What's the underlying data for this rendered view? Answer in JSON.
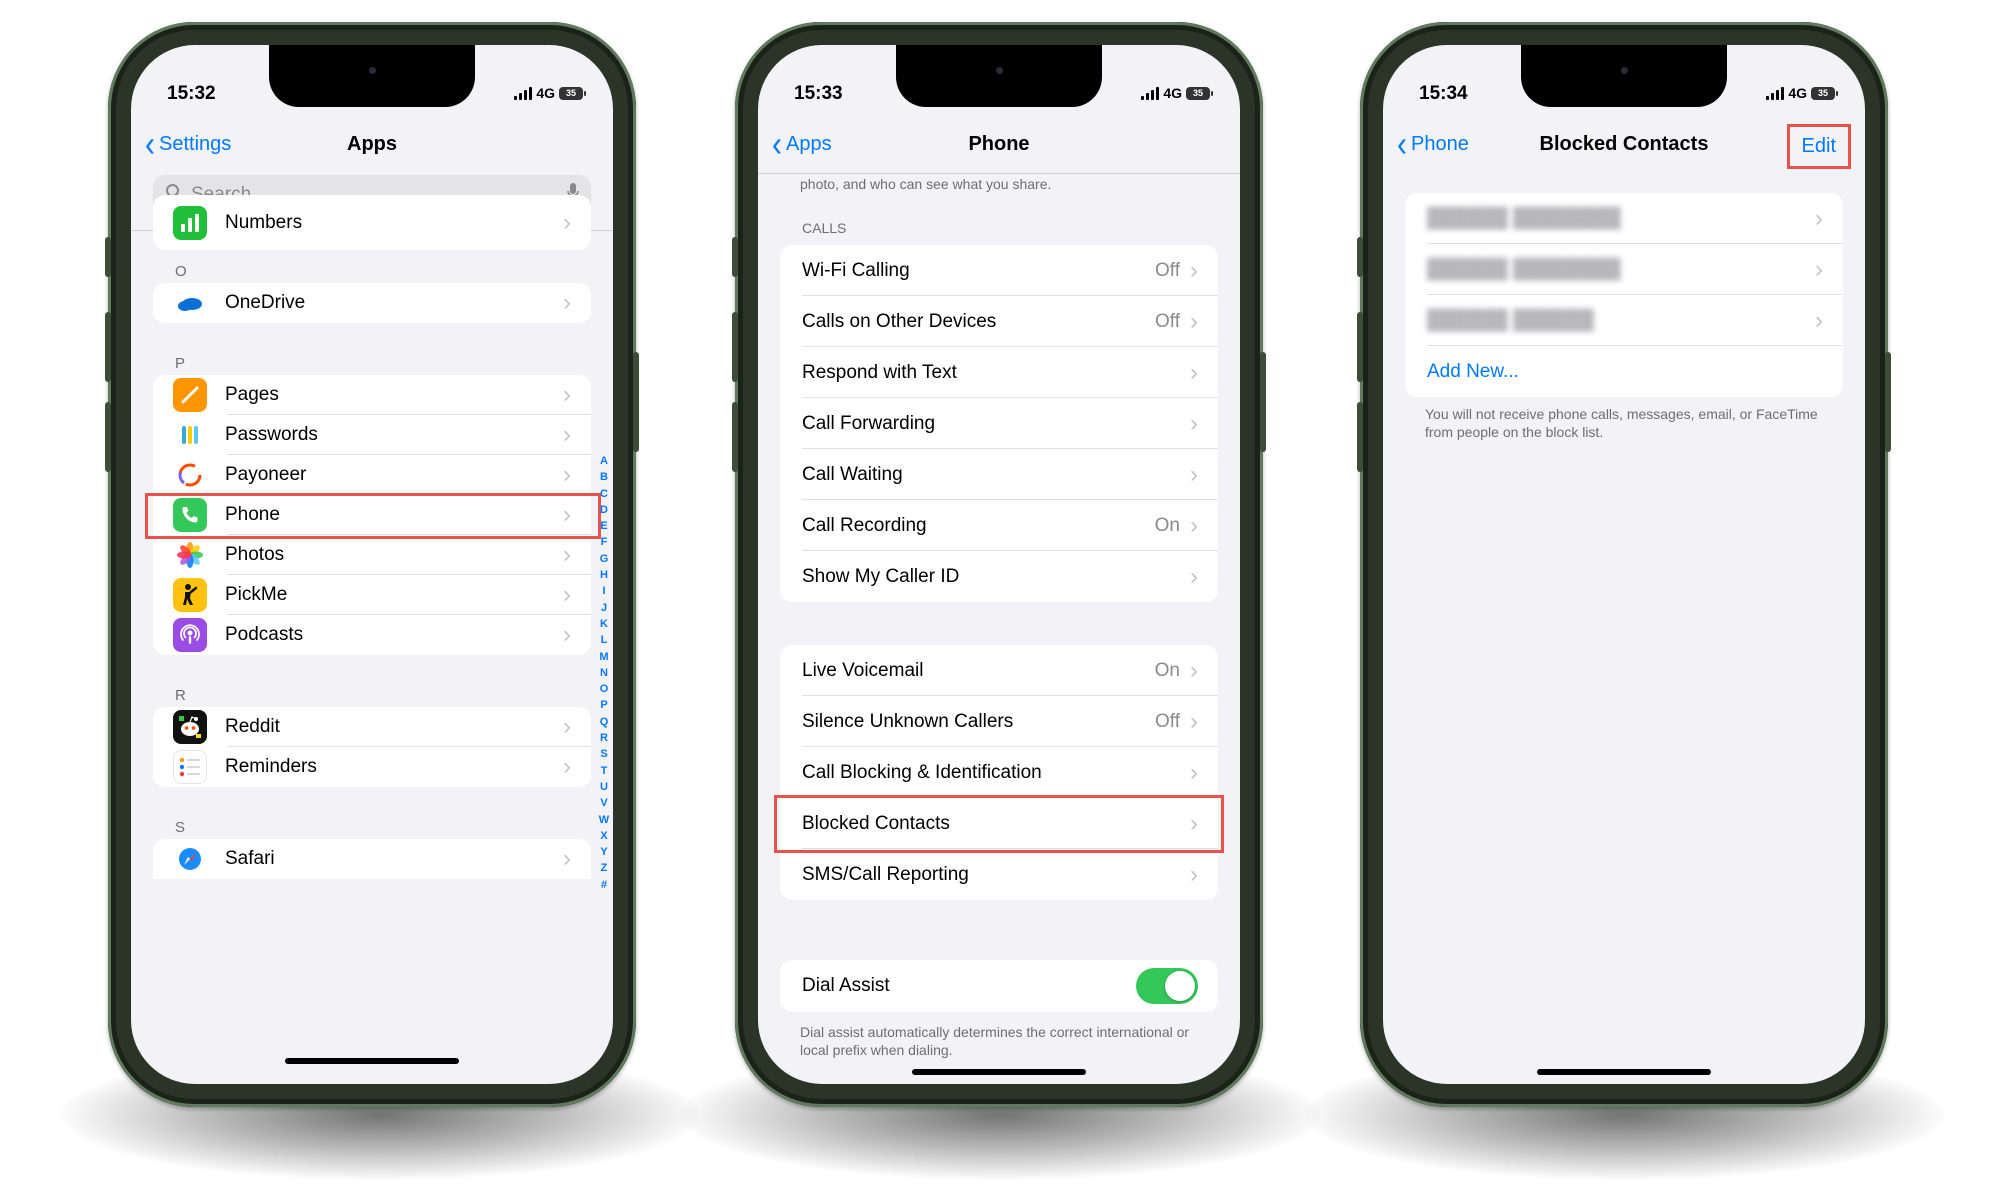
{
  "colors": {
    "ios_blue": "#007aff",
    "highlight_red": "#e8524a",
    "toggle_green": "#34c759",
    "frame": "#2a3528"
  },
  "phone1": {
    "time": "15:32",
    "network": "4G",
    "battery": "35",
    "nav": {
      "back_label": "Settings",
      "title": "Apps"
    },
    "search_placeholder": "Search",
    "section_o": "O",
    "section_p": "P",
    "section_r": "R",
    "section_s": "S",
    "apps": {
      "numbers": "Numbers",
      "onedrive": "OneDrive",
      "pages": "Pages",
      "passwords": "Passwords",
      "payoneer": "Payoneer",
      "phone": "Phone",
      "photos": "Photos",
      "pickme": "PickMe",
      "podcasts": "Podcasts",
      "reddit": "Reddit",
      "reminders": "Reminders",
      "safari": "Safari"
    },
    "index_letters": [
      "A",
      "B",
      "C",
      "D",
      "E",
      "F",
      "G",
      "H",
      "I",
      "J",
      "K",
      "L",
      "M",
      "N",
      "O",
      "P",
      "Q",
      "R",
      "S",
      "T",
      "U",
      "V",
      "W",
      "X",
      "Y",
      "Z",
      "#"
    ],
    "icons": [
      "numbers-icon",
      "onedrive-icon",
      "pages-icon",
      "passwords-icon",
      "payoneer-icon",
      "phone-icon",
      "photos-icon",
      "pickme-icon",
      "podcasts-icon",
      "reddit-icon",
      "reminders-icon",
      "safari-icon"
    ]
  },
  "phone2": {
    "time": "15:33",
    "network": "4G",
    "battery": "35",
    "nav": {
      "back_label": "Apps",
      "title": "Phone"
    },
    "top_note": "photo, and who can see what you share.",
    "calls_header": "CALLS",
    "calls": [
      {
        "label": "Wi-Fi Calling",
        "value": "Off"
      },
      {
        "label": "Calls on Other Devices",
        "value": "Off"
      },
      {
        "label": "Respond with Text",
        "value": ""
      },
      {
        "label": "Call Forwarding",
        "value": ""
      },
      {
        "label": "Call Waiting",
        "value": ""
      },
      {
        "label": "Call Recording",
        "value": "On"
      },
      {
        "label": "Show My Caller ID",
        "value": ""
      }
    ],
    "group2": [
      {
        "label": "Live Voicemail",
        "value": "On"
      },
      {
        "label": "Silence Unknown Callers",
        "value": "Off"
      },
      {
        "label": "Call Blocking & Identification",
        "value": ""
      },
      {
        "label": "Blocked Contacts",
        "value": ""
      },
      {
        "label": "SMS/Call Reporting",
        "value": ""
      }
    ],
    "dial_assist": {
      "label": "Dial Assist",
      "enabled": true
    },
    "dial_assist_note": "Dial assist automatically determines the correct international or local prefix when dialing."
  },
  "phone3": {
    "time": "15:34",
    "network": "4G",
    "battery": "35",
    "nav": {
      "back_label": "Phone",
      "title": "Blocked Contacts",
      "edit_label": "Edit"
    },
    "add_new": "Add New...",
    "footer": "You will not receive phone calls, messages, email, or FaceTime from people on the block list."
  }
}
